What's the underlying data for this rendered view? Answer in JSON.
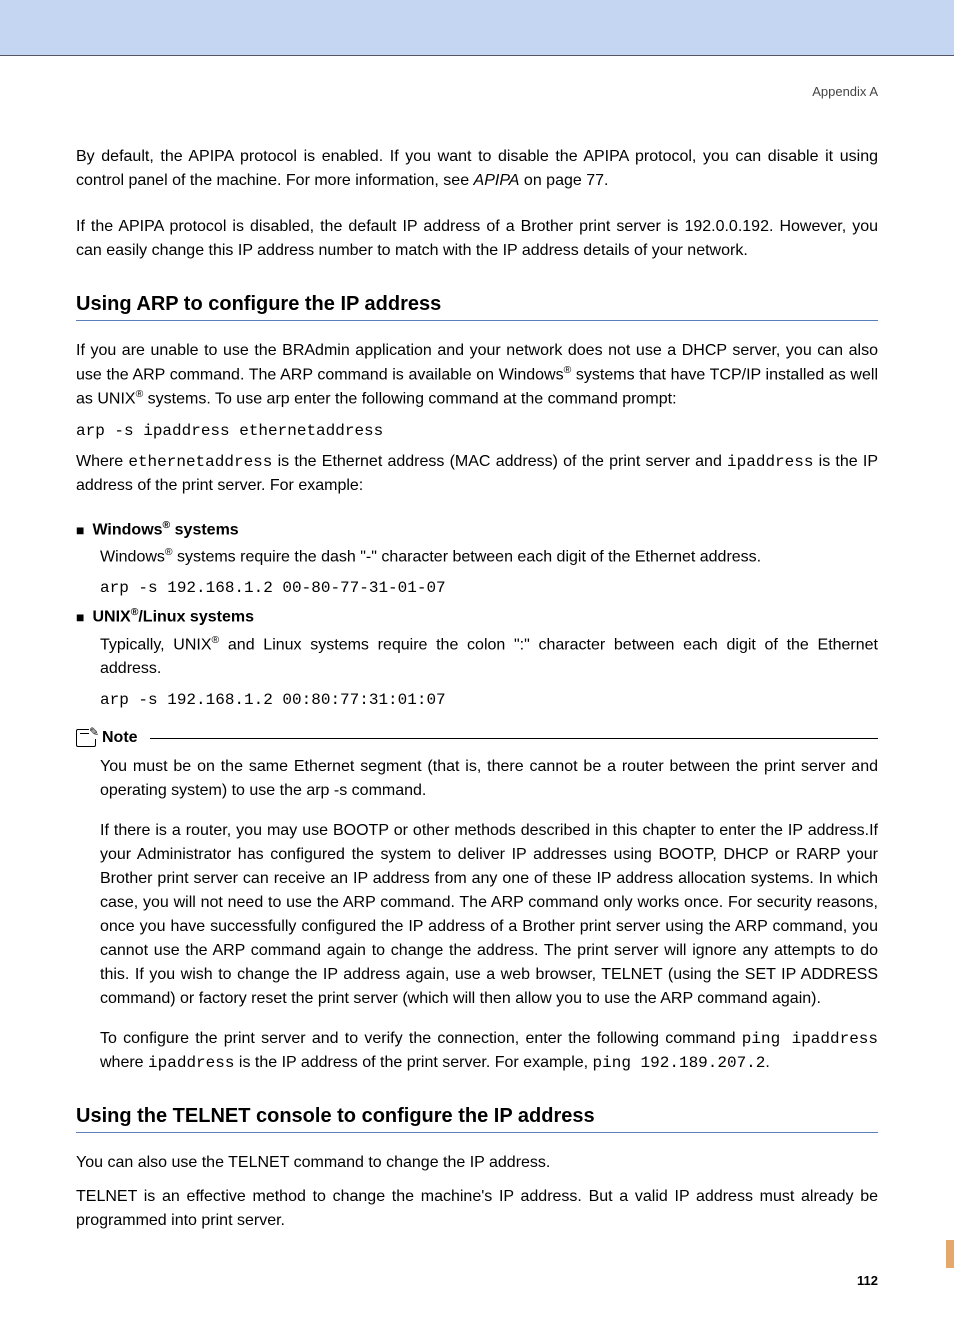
{
  "header": {
    "appendix": "Appendix A"
  },
  "intro": {
    "p1a": "By default, the APIPA protocol is enabled. If you want to disable the APIPA protocol, you can disable it using control panel of the machine. For more information, see ",
    "p1b": "APIPA",
    "p1c": " on page 77.",
    "p2": "If the APIPA protocol is disabled, the default IP address of a Brother print server is 192.0.0.192. However, you can easily change this IP address number to match with the IP address details of your network."
  },
  "arp": {
    "heading": "Using ARP to configure the IP address",
    "p1a": "If you are unable to use the BRAdmin application and your network does not use a DHCP server, you can also use the ARP command. The ARP command is available on Windows",
    "p1b": " systems that have TCP/IP installed as well as UNIX",
    "p1c": " systems. To use arp enter the following command at the command prompt:",
    "cmd1": "arp -s ipaddress ethernetaddress",
    "p2a": "Where ",
    "p2b": "ethernetaddress",
    "p2c": " is the Ethernet address (MAC address) of the print server and ",
    "p2d": "ipaddress",
    "p2e": " is the IP address of the print server. For example:",
    "win": {
      "label_a": "Windows",
      "label_b": " systems",
      "p1a": "Windows",
      "p1b": " systems require the dash \"-\" character between each digit of the Ethernet address.",
      "cmd": "arp -s 192.168.1.2 00-80-77-31-01-07"
    },
    "unix": {
      "label_a": "UNIX",
      "label_b": "/Linux systems",
      "p1a": "Typically, UNIX",
      "p1b": " and Linux systems require the colon \":\" character between each digit of the Ethernet address.",
      "cmd": "arp -s 192.168.1.2 00:80:77:31:01:07"
    }
  },
  "note": {
    "title": "Note",
    "p1": "You must be on the same Ethernet segment (that is, there cannot be a router between the print server and operating system) to use the arp -s command.",
    "p2": "If there is a router, you may use BOOTP or other methods described in this chapter to enter the IP address.If your Administrator has configured the system to deliver IP addresses using BOOTP, DHCP or RARP your Brother print server can receive an IP address from any one of these IP address allocation systems. In which case, you will not need to use the ARP command. The ARP command only works once. For security reasons, once you have successfully configured the IP address of a Brother print server using the ARP command, you cannot use the ARP command again to change the address. The print server will ignore any attempts to do this. If you wish to change the IP address again, use a web browser, TELNET (using the SET IP ADDRESS command) or factory reset the print server (which will then allow you to use the ARP command again).",
    "p3a": "To configure the print server and to verify the connection, enter the following command ",
    "p3b": "ping ipaddress",
    "p3c": " where ",
    "p3d": "ipaddress",
    "p3e": " is the IP address of the print server. For example, ",
    "p3f": "ping 192.189.207.2",
    "p3g": "."
  },
  "telnet": {
    "heading": "Using the TELNET console to configure the IP address",
    "p1": "You can also use the TELNET command to change the IP address.",
    "p2": "TELNET is an effective method to change the machine's IP address. But a valid IP address must already be programmed into print server."
  },
  "footer": {
    "page": "112"
  },
  "glyphs": {
    "reg": "®",
    "square": "■"
  }
}
